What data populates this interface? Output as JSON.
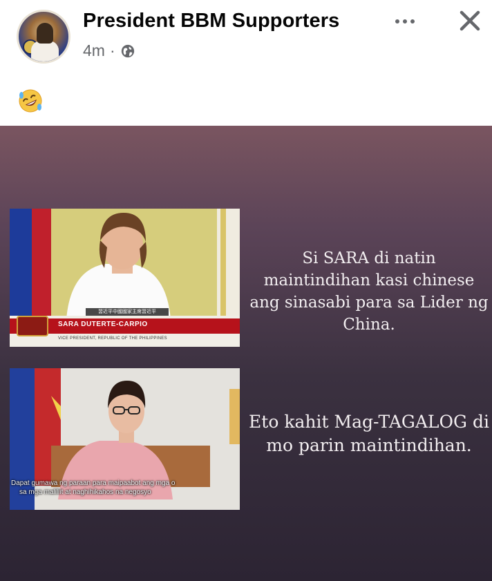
{
  "post": {
    "page_name": "President BBM Supporters",
    "time": "4m",
    "separator": "·",
    "audience_icon": "globe-icon",
    "caption_emoji": "rolling-on-floor-laughing"
  },
  "meme": {
    "panel1": {
      "lower_third_name": "SARA DUTERTE-CARPIO",
      "lower_third_title": "VICE PRESIDENT, REPUBLIC OF THE PHILIPPINES",
      "subtitle": "習近平中國國家主席習近平",
      "caption": "Si SARA di natin maintindihan kasi chinese ang sinasabi para sa Lider ng China."
    },
    "panel2": {
      "subtitle_line1": "Dapat gumawa ng paraan para maipaabot ang mga o",
      "subtitle_line2": "sa mga maliliit at naghihikahos na negosyo",
      "caption": "Eto kahit Mag-TAGALOG di mo parin maintindihan."
    }
  },
  "colors": {
    "meta_gray": "#65676b",
    "name_black": "#050505",
    "caption_text": "#f2eef0"
  }
}
